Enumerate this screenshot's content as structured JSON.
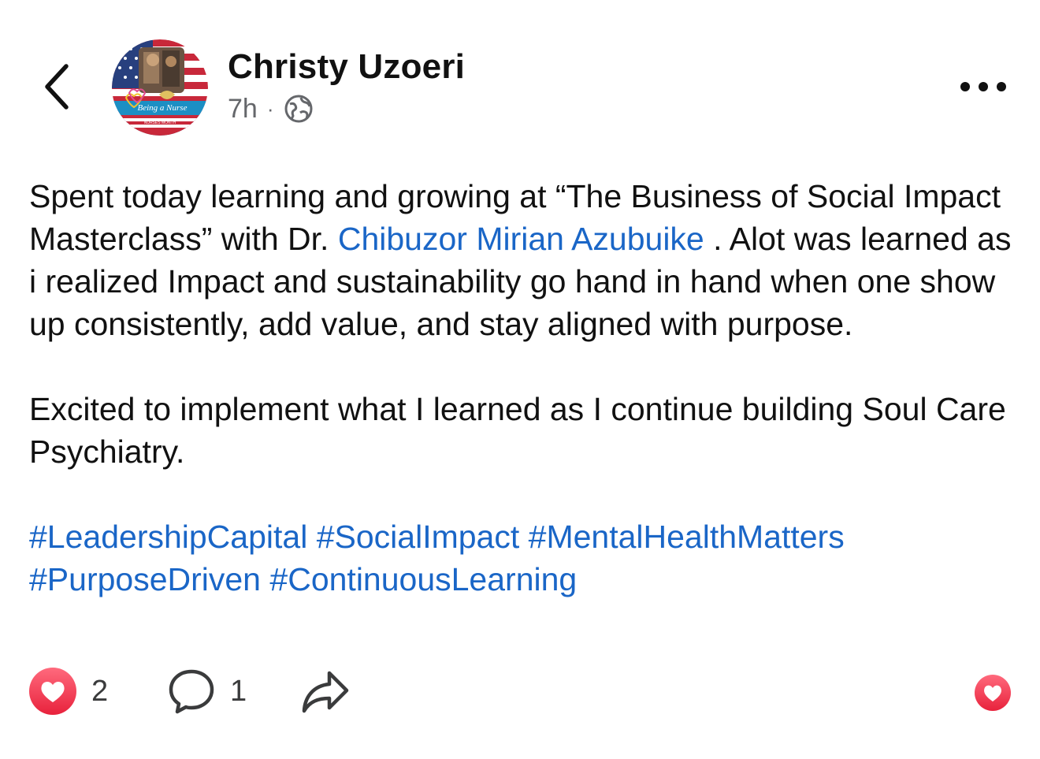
{
  "header": {
    "author_name": "Christy Uzoeri",
    "timestamp": "7h",
    "separator": "·",
    "audience_icon": "globe-icon",
    "avatar_text": "Being a Nurse",
    "avatar_subtext": "NURSES MONTH"
  },
  "post": {
    "paragraph1_part1": "Spent today learning and growing at “The Business of Social Impact Masterclass” with Dr. ",
    "mention": "Chibuzor Mirian Azubuike",
    "paragraph1_part2": " . Alot was learned as i realized Impact and sustainability go hand in hand when one show up consistently, add value, and stay aligned with purpose.",
    "paragraph2": "Excited to implement what I learned as I continue building Soul Care Psychiatry.",
    "hashtags": [
      "#LeadershipCapital",
      "#SocialImpact",
      "#MentalHealthMatters",
      "#PurposeDriven",
      "#ContinuousLearning"
    ]
  },
  "actions": {
    "reaction_count": "2",
    "comment_count": "1"
  },
  "colors": {
    "link": "#1a66c7",
    "heart": "#f0344e",
    "meta": "#65676b"
  }
}
